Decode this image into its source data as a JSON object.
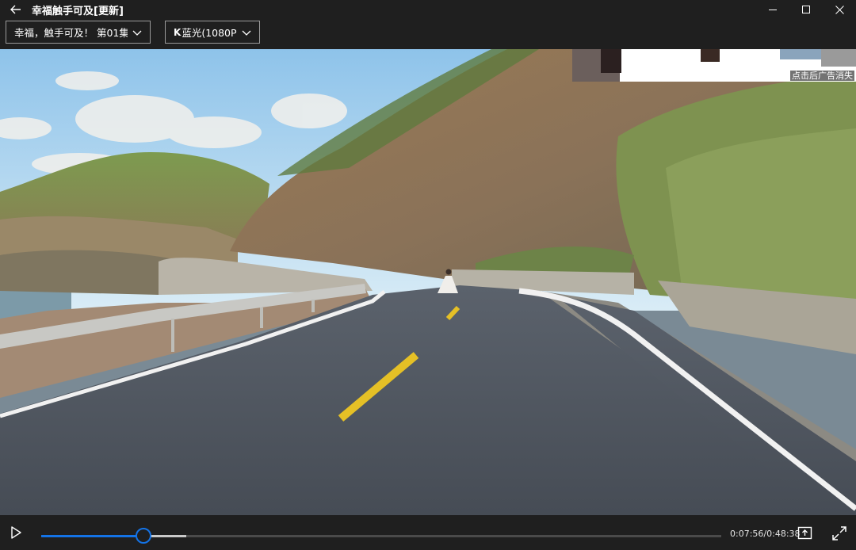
{
  "window": {
    "title": "幸福触手可及[更新]",
    "back_icon": "arrow-left-icon",
    "minimize_icon": "minimize-icon",
    "maximize_icon": "maximize-icon",
    "close_icon": "close-icon"
  },
  "selectors": {
    "episode": {
      "value": "幸福，触手可及！ 第01集",
      "icon": "chevron-down-icon"
    },
    "quality": {
      "badge": "K",
      "value": "蓝光(1080P)",
      "icon": "chevron-down-icon"
    }
  },
  "ad": {
    "label": "点击后广告消失"
  },
  "player": {
    "state": "paused",
    "current_time": "0:07:56",
    "total_time": "0:48:38",
    "time_display": "0:07:56/0:48:38",
    "progress_fraction": 0.1498,
    "buffered_fraction": 0.2131,
    "accent_color": "#1473e6",
    "play_icon": "play-icon",
    "mini_icon": "picture-in-picture-icon",
    "fullscreen_icon": "fullscreen-icon"
  }
}
